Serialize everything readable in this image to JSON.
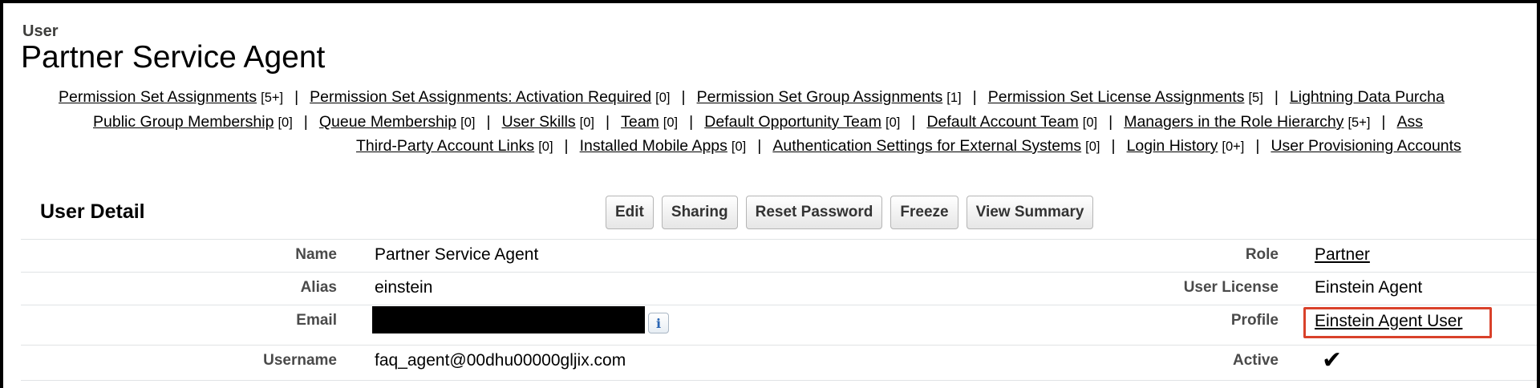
{
  "header": {
    "object_type": "User",
    "title": "Partner Service Agent"
  },
  "related_lists": {
    "row1": [
      {
        "label": "Permission Set Assignments",
        "count": "[5+]"
      },
      {
        "label": "Permission Set Assignments: Activation Required",
        "count": "[0]"
      },
      {
        "label": "Permission Set Group Assignments",
        "count": "[1]"
      },
      {
        "label": "Permission Set License Assignments",
        "count": "[5]"
      },
      {
        "label": "Lightning Data Purcha",
        "count": ""
      }
    ],
    "row2": [
      {
        "label": "Public Group Membership",
        "count": "[0]"
      },
      {
        "label": "Queue Membership",
        "count": "[0]"
      },
      {
        "label": "User Skills",
        "count": "[0]"
      },
      {
        "label": "Team",
        "count": "[0]"
      },
      {
        "label": "Default Opportunity Team",
        "count": "[0]"
      },
      {
        "label": "Default Account Team",
        "count": "[0]"
      },
      {
        "label": "Managers in the Role Hierarchy",
        "count": "[5+]"
      },
      {
        "label": "Ass",
        "count": ""
      }
    ],
    "row3": [
      {
        "label": "Third-Party Account Links",
        "count": "[0]"
      },
      {
        "label": "Installed Mobile Apps",
        "count": "[0]"
      },
      {
        "label": "Authentication Settings for External Systems",
        "count": "[0]"
      },
      {
        "label": "Login History",
        "count": "[0+]"
      },
      {
        "label": "User Provisioning Accounts",
        "count": ""
      }
    ],
    "separator": "|"
  },
  "detail": {
    "section_title": "User Detail",
    "buttons": {
      "edit": "Edit",
      "sharing": "Sharing",
      "reset_password": "Reset Password",
      "freeze": "Freeze",
      "view_summary": "View Summary"
    },
    "fields": {
      "name_label": "Name",
      "name_value": "Partner Service Agent",
      "alias_label": "Alias",
      "alias_value": "einstein",
      "email_label": "Email",
      "username_label": "Username",
      "username_value": "faq_agent@00dhu00000gljix.com",
      "role_label": "Role",
      "role_value": "Partner",
      "license_label": "User License",
      "license_value": "Einstein Agent",
      "profile_label": "Profile",
      "profile_value": "Einstein Agent User",
      "active_label": "Active",
      "active_value": "✔"
    },
    "info_icon": "i"
  },
  "colors": {
    "highlight": "#d9412a",
    "info_icon": "#2a65b3"
  }
}
